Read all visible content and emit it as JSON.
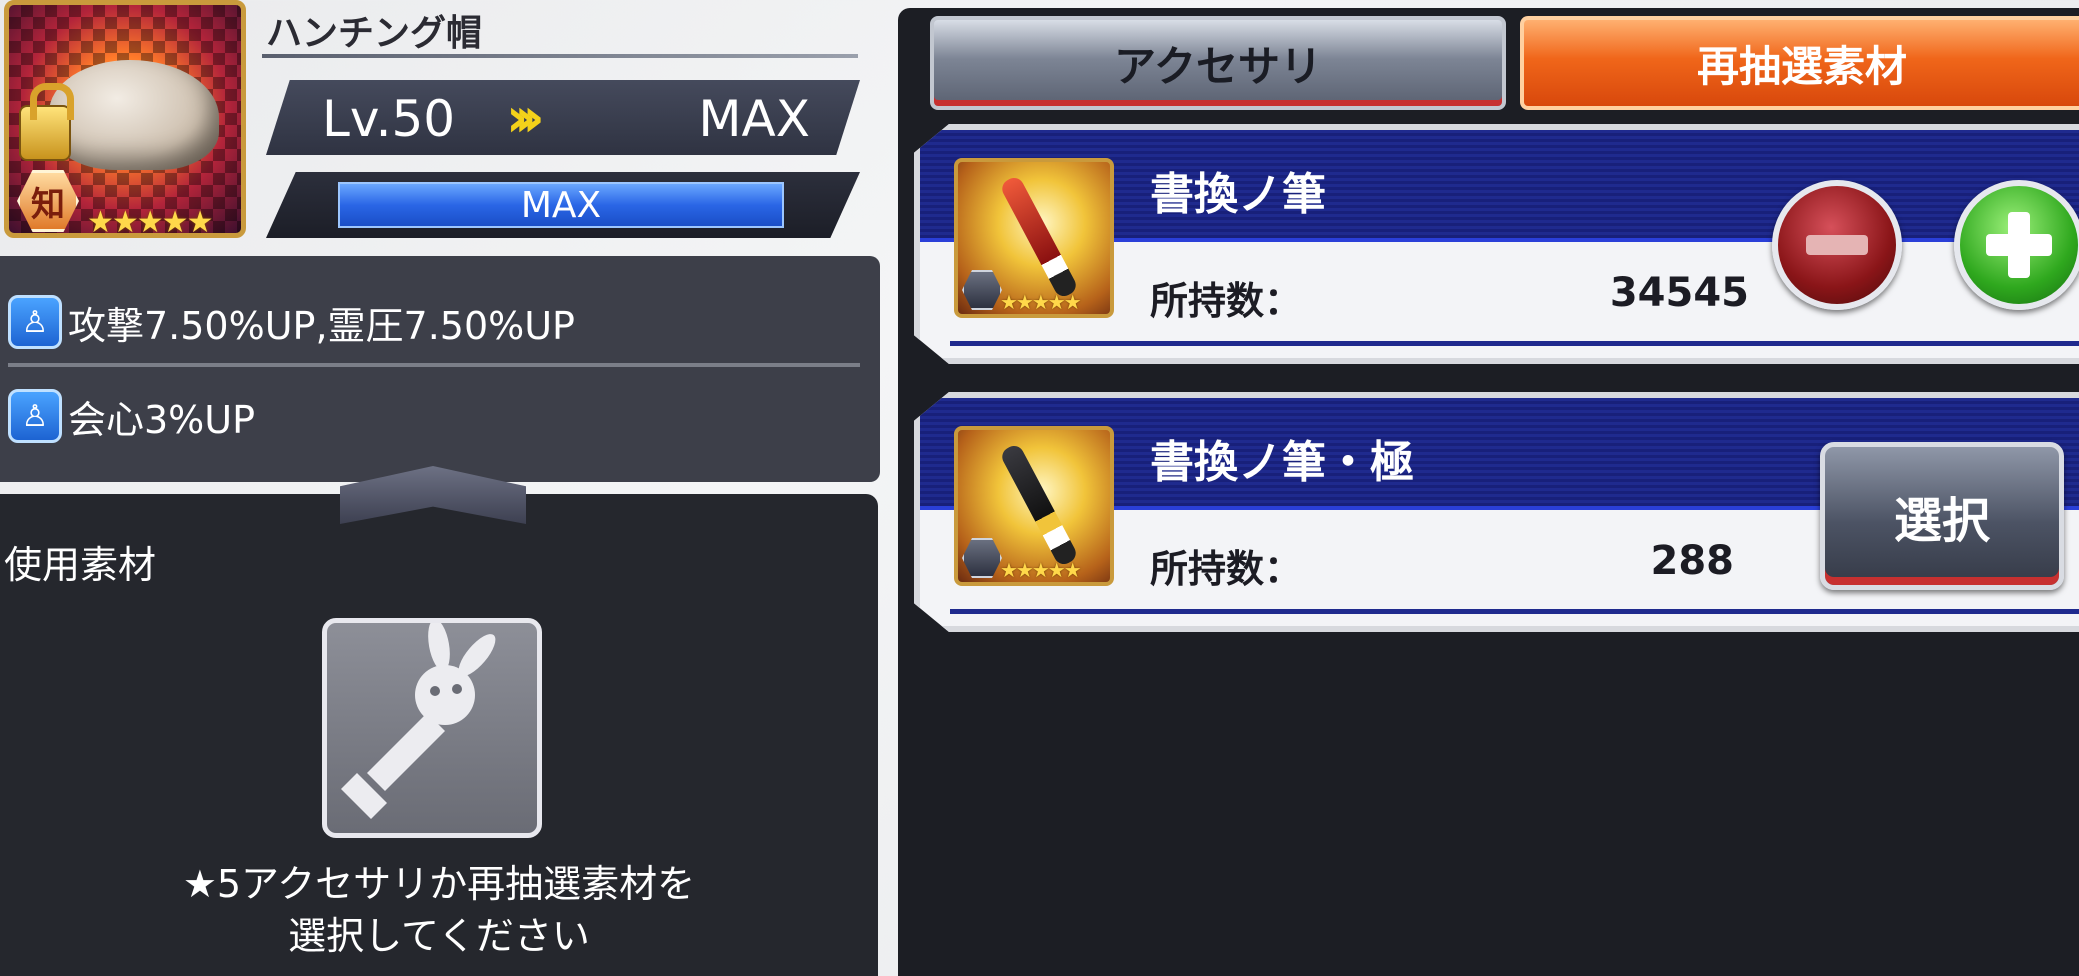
{
  "accessory": {
    "name": "ハンチング帽",
    "attribute_label": "知",
    "stars": "★★★★★",
    "level_text": "Lv.50",
    "level_arrow": "»",
    "level_max_text": "MAX",
    "exp_text": "MAX",
    "exp_progress": 1.0
  },
  "effects": [
    {
      "icon": "person-icon",
      "text": "攻撃7.50%UP,霊圧7.50%UP"
    },
    {
      "icon": "person-icon",
      "text": "会心3%UP"
    }
  ],
  "materials_panel": {
    "title": "使用素材",
    "hint_line1": "★5アクセサリか再抽選素材を",
    "hint_line2": "選択してください"
  },
  "tabs": {
    "accessory": "アクセサリ",
    "reroll_material": "再抽選素材"
  },
  "material_list": [
    {
      "name": "書換ノ筆",
      "owned_label": "所持数：",
      "owned_count": "34545",
      "stars": "★★★★★"
    },
    {
      "name": "書換ノ筆・極",
      "owned_label": "所持数：",
      "owned_count": "288",
      "stars": "★★★★★",
      "select_label": "選択"
    }
  ],
  "colors": {
    "active_tab": "#f0661a",
    "exp_bar": "#2a66e6",
    "card_band": "#1f2a8e",
    "plus_button": "#2fa81e",
    "minus_button": "#8a1518"
  }
}
